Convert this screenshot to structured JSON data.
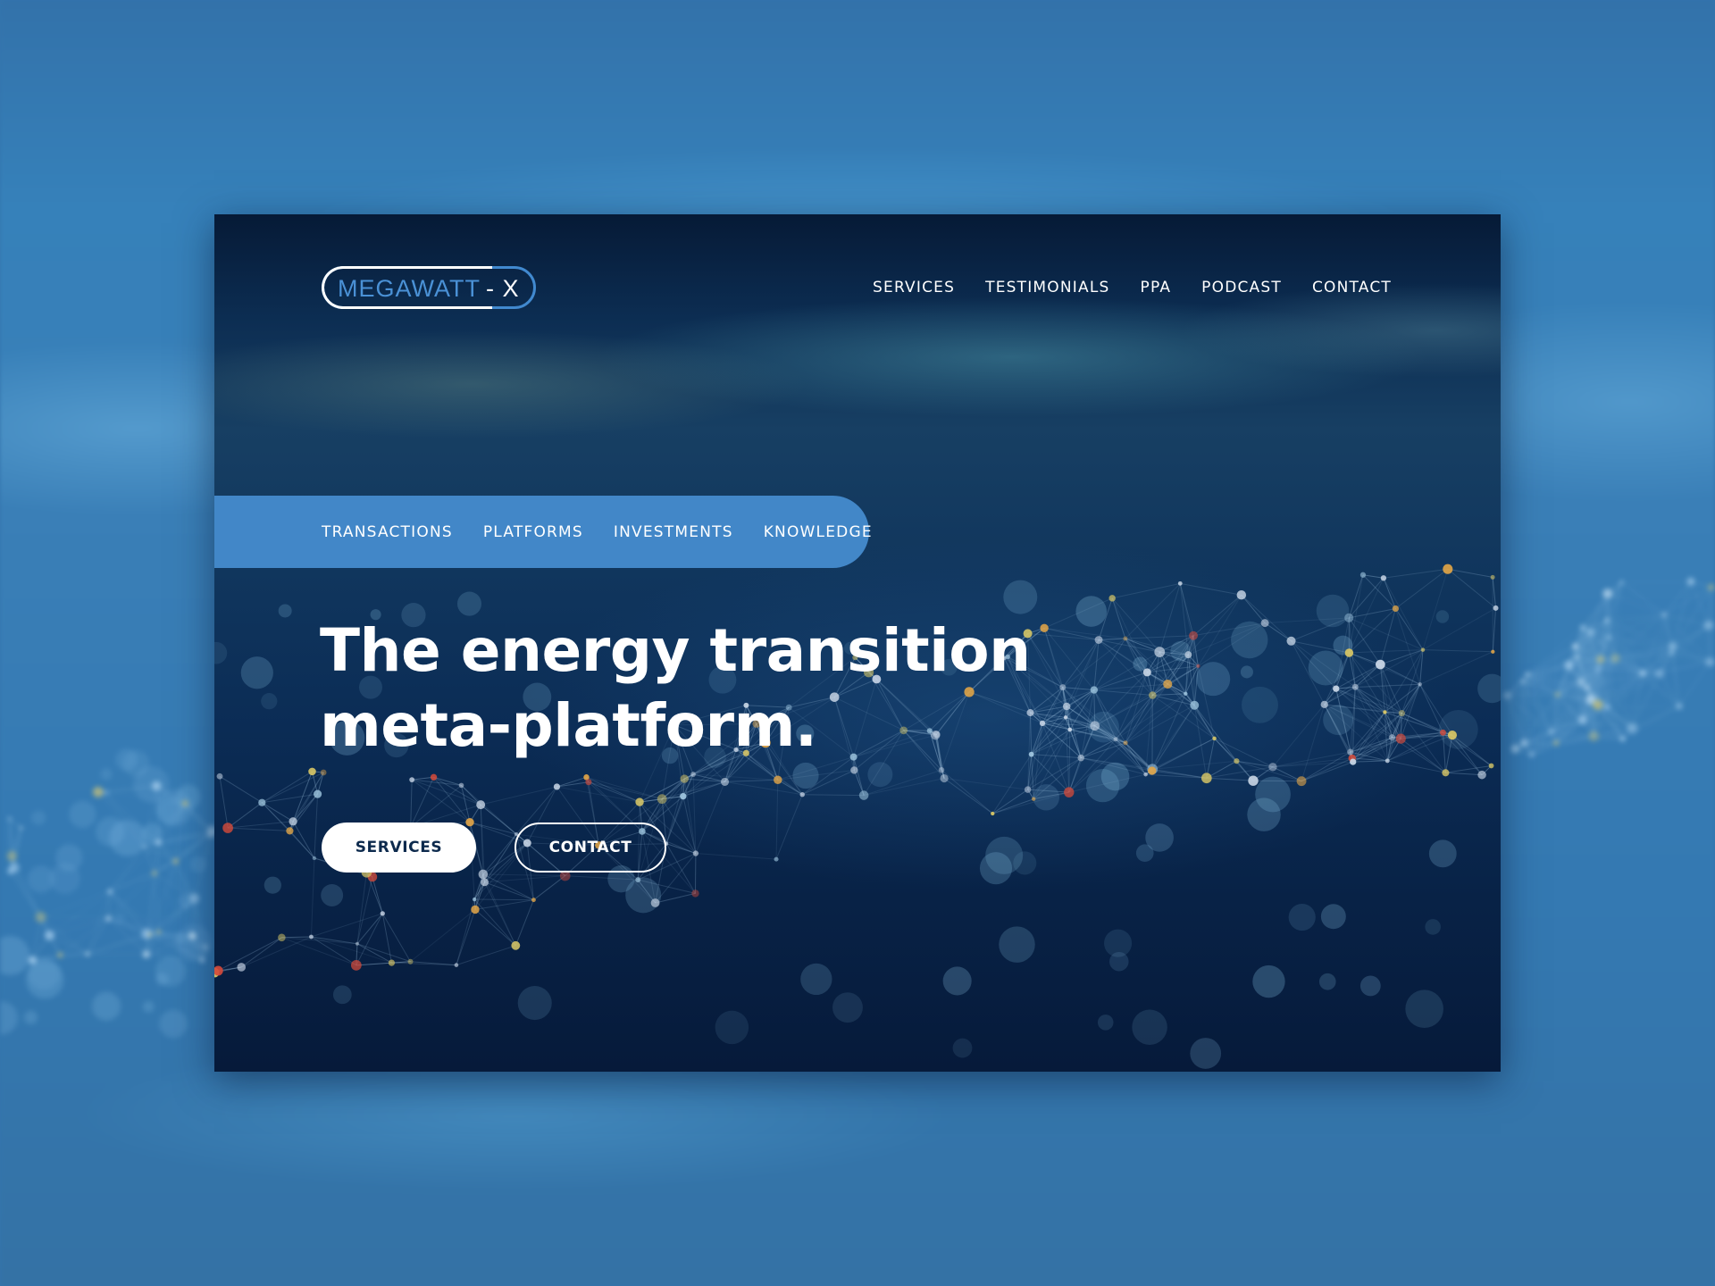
{
  "brand": {
    "name_main": "MEGAWATT",
    "name_suffix": "- X",
    "accent_color": "#4287c8"
  },
  "topnav": {
    "items": [
      {
        "label": "SERVICES"
      },
      {
        "label": "TESTIMONIALS"
      },
      {
        "label": "PPA"
      },
      {
        "label": "PODCAST"
      },
      {
        "label": "CONTACT"
      }
    ]
  },
  "subnav": {
    "items": [
      {
        "label": "TRANSACTIONS"
      },
      {
        "label": "PLATFORMS"
      },
      {
        "label": "INVESTMENTS"
      },
      {
        "label": "KNOWLEDGE"
      }
    ]
  },
  "hero": {
    "headline_line1": "The energy transition",
    "headline_line2": "meta-platform.",
    "background_image": "network-particles-image",
    "cta_primary": "SERVICES",
    "cta_secondary": "CONTACT"
  }
}
